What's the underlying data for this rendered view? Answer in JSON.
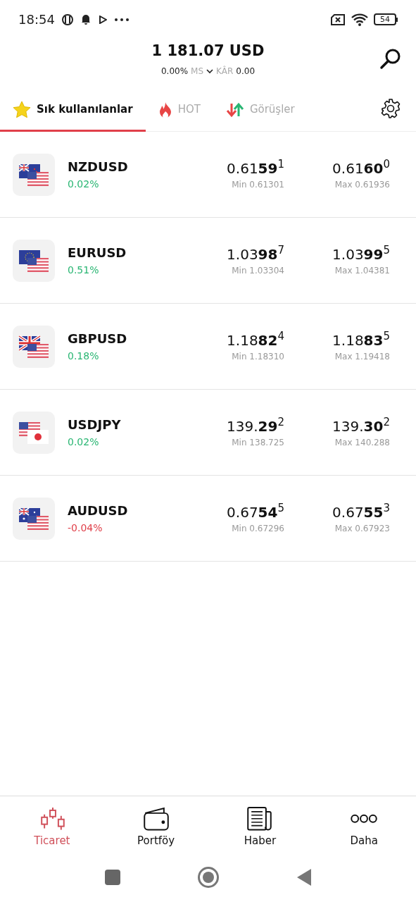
{
  "status_bar": {
    "time": "18:54",
    "battery": "54"
  },
  "header": {
    "balance": "1 181.07 USD",
    "percent": "0.00%",
    "margin_label": "MS",
    "profit_label": "KÂR",
    "profit": "0.00"
  },
  "tabs": [
    {
      "label": "Sık kullanılanlar",
      "kind": "star",
      "selected": true
    },
    {
      "label": "HOT",
      "kind": "fire",
      "selected": false
    },
    {
      "label": "Görüşler",
      "kind": "arrows",
      "selected": false
    }
  ],
  "instruments": [
    {
      "symbol": "NZDUSD",
      "change": "0.02%",
      "color": "#2ab673",
      "kind": "nzusd",
      "bid": "0.61**59**$^{1}$",
      "low": "Min 0.61301",
      "ask": "0.61**60**$^{0}$",
      "high": "Max 0.61936"
    },
    {
      "symbol": "EURUSD",
      "change": "0.51%",
      "color": "#2ab673",
      "kind": "eurusd",
      "bid": "1.03**98**$^{7}$",
      "low": "Min 1.03304",
      "ask": "1.03**99**$^{5}$",
      "high": "Max 1.04381"
    },
    {
      "symbol": "GBPUSD",
      "change": "0.18%",
      "color": "#2ab673",
      "kind": "gbpusd",
      "bid": "1.18**82**$^{4}$",
      "low": "Min 1.18310",
      "ask": "1.18**83**$^{5}$",
      "high": "Max 1.19418"
    },
    {
      "symbol": "USDJPY",
      "change": "0.02%",
      "color": "#2ab673",
      "kind": "usdjpy",
      "bid": "139.**29**$^{2}$",
      "low": "Min 138.725",
      "ask": "139.**30**$^{2}$",
      "high": "Max 140.288"
    },
    {
      "symbol": "AUDUSD",
      "change": "-0.04%",
      "color": "#e0404a",
      "kind": "audusd",
      "bid": "0.67**54**$^{5}$",
      "low": "Min 0.67296",
      "ask": "0.67**55**$^{3}$",
      "high": "Max 0.67923"
    }
  ],
  "bottom_nav": [
    {
      "label": "Ticaret",
      "kind": "candles",
      "selected": true
    },
    {
      "label": "Portföy",
      "kind": "wallet",
      "selected": false
    },
    {
      "label": "Haber",
      "kind": "news",
      "selected": false
    },
    {
      "label": "Daha",
      "kind": "more",
      "selected": false
    }
  ]
}
